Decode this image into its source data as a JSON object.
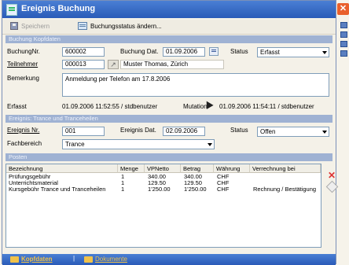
{
  "window": {
    "title": "Ereignis Buchung"
  },
  "toolbar": {
    "save_label": "Speichern",
    "status_change_label": "Buchungsstatus ändern..."
  },
  "buchung": {
    "section_title": "Buchung Kopfdaten",
    "nr_label": "BuchungNr.",
    "nr_value": "600002",
    "datum_label": "Buchung Dat.",
    "datum_value": "01.09.2006",
    "status_label": "Status",
    "status_value": "Erfasst",
    "teilnehmer_label": "Teilnehmer",
    "teilnehmer_id": "000013",
    "teilnehmer_name": "Muster Thomas, Zürich",
    "bemerkung_label": "Bemerkung",
    "bemerkung_value": "Anmeldung per Telefon am 17.8.2006",
    "erfasst_label": "Erfasst",
    "erfasst_value": "01.09.2006 11:52:55 / stdbenutzer",
    "mutation_label": "Mutation",
    "mutation_value": "01.09.2006 11:54:11 / stdbenutzer"
  },
  "ereignis": {
    "section_title": "Ereignis: Trance und Tranceheilen",
    "nr_label": "Ereignis Nr.",
    "nr_value": "001",
    "datum_label": "Ereignis Dat.",
    "datum_value": "02.09.2006",
    "status_label": "Status",
    "status_value": "Offen",
    "fachbereich_label": "Fachbereich",
    "fachbereich_value": "Trance"
  },
  "posten": {
    "section_title": "Posten",
    "columns": [
      "Bezeichnung",
      "Menge",
      "VPNetto",
      "Betrag",
      "Währung",
      "Verrechnung bei"
    ],
    "rows": [
      [
        "Prüfungsgebühr",
        "1",
        "340.00",
        "340.00",
        "CHF",
        ""
      ],
      [
        "Unterrichtsmaterial",
        "1",
        "129.50",
        "129.50",
        "CHF",
        ""
      ],
      [
        "Kursgebühr Trance und Tranceheilen",
        "1",
        "1'250.00",
        "1'250.00",
        "CHF",
        "Rechnung / Bestätigung"
      ]
    ]
  },
  "bottom": {
    "tab1": "Kopfdaten",
    "tab2": "Dokumente"
  },
  "colors": {
    "titlebar": "#2a5bb8",
    "section": "#9fb2d3",
    "close": "#e9602c"
  }
}
